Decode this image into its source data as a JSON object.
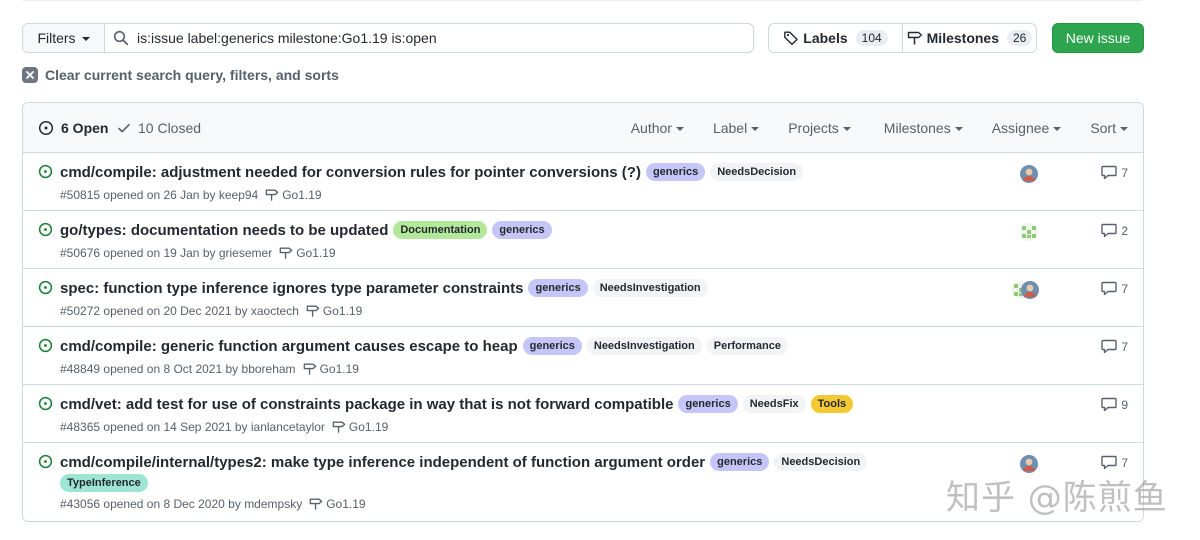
{
  "toolbar": {
    "filters_label": "Filters",
    "search_value": "is:issue label:generics milestone:Go1.19 is:open",
    "labels_label": "Labels",
    "labels_count": "104",
    "milestones_label": "Milestones",
    "milestones_count": "26",
    "new_issue_label": "New issue"
  },
  "clear_text": "Clear current search query, filters, and sorts",
  "header": {
    "open_label": "6 Open",
    "closed_label": "10 Closed",
    "menus": [
      "Author",
      "Label",
      "Projects",
      "Milestones",
      "Assignee",
      "Sort"
    ]
  },
  "colors": {
    "accent_green": "#1a7f37",
    "generics": "#c5c6f7",
    "documentation": "#b3e89a",
    "typeinference": "#9fe5d6",
    "tools": "#f5c934",
    "neutral_label": "#f1f3f5"
  },
  "issues": [
    {
      "title": "cmd/compile: adjustment needed for conversion rules for pointer conversions (?)",
      "labels": [
        "generics",
        "NeedsDecision"
      ],
      "number": "#50815",
      "opened": "opened on 26 Jan by",
      "author": "keep94",
      "milestone": "Go1.19",
      "comments": "7",
      "avatar": "person"
    },
    {
      "title": "go/types: documentation needs to be updated",
      "labels": [
        "Documentation",
        "generics"
      ],
      "number": "#50676",
      "opened": "opened on 19 Jan by",
      "author": "griesemer",
      "milestone": "Go1.19",
      "comments": "2",
      "avatar": "identicon"
    },
    {
      "title": "spec: function type inference ignores type parameter constraints",
      "labels": [
        "generics",
        "NeedsInvestigation"
      ],
      "number": "#50272",
      "opened": "opened on 20 Dec 2021 by",
      "author": "xaoctech",
      "milestone": "Go1.19",
      "comments": "7",
      "avatar": "stacked"
    },
    {
      "title": "cmd/compile: generic function argument causes escape to heap",
      "labels": [
        "generics",
        "NeedsInvestigation",
        "Performance"
      ],
      "number": "#48849",
      "opened": "opened on 8 Oct 2021 by",
      "author": "bboreham",
      "milestone": "Go1.19",
      "comments": "7",
      "avatar": "none"
    },
    {
      "title": "cmd/vet: add test for use of constraints package in way that is not forward compatible",
      "labels": [
        "generics",
        "NeedsFix",
        "Tools"
      ],
      "number": "#48365",
      "opened": "opened on 14 Sep 2021 by",
      "author": "ianlancetaylor",
      "milestone": "Go1.19",
      "comments": "9",
      "avatar": "none"
    },
    {
      "title": "cmd/compile/internal/types2: make type inference independent of function argument order",
      "labels": [
        "generics",
        "NeedsDecision"
      ],
      "extra_labels": [
        "TypeInference"
      ],
      "number": "#43056",
      "opened": "opened on 8 Dec 2020 by",
      "author": "mdempsky",
      "milestone": "Go1.19",
      "comments": "7",
      "avatar": "person"
    }
  ],
  "watermark": "知乎 @陈煎鱼"
}
